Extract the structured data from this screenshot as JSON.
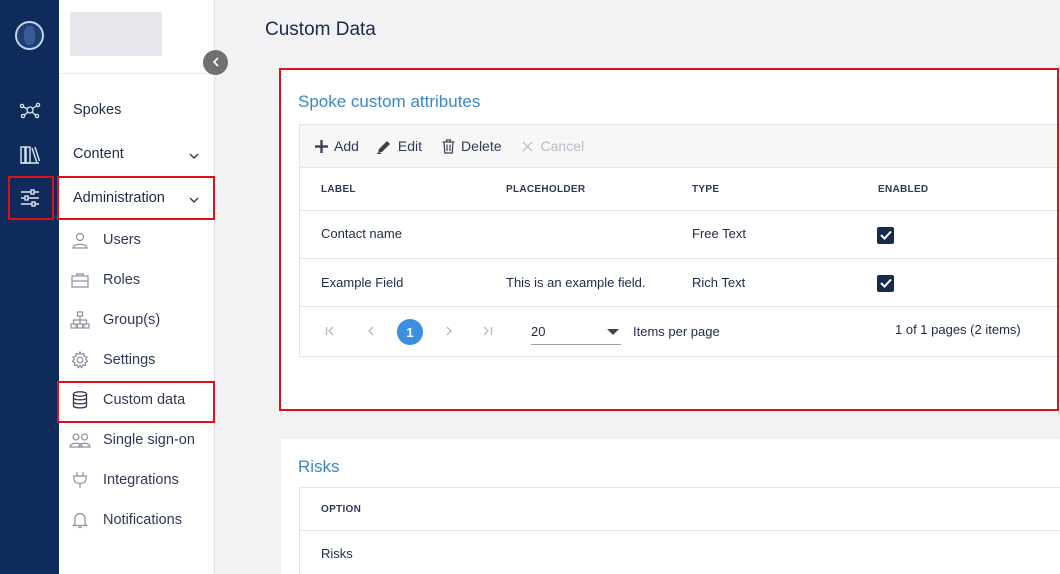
{
  "page": {
    "title": "Custom Data"
  },
  "nav": {
    "top_items": [
      {
        "label": "Spokes"
      },
      {
        "label": "Content"
      },
      {
        "label": "Administration"
      }
    ],
    "sub_items": [
      {
        "label": "Users",
        "icon": "user-icon"
      },
      {
        "label": "Roles",
        "icon": "briefcase-icon"
      },
      {
        "label": "Group(s)",
        "icon": "hierarchy-icon"
      },
      {
        "label": "Settings",
        "icon": "gear-icon"
      },
      {
        "label": "Custom data",
        "icon": "database-icon"
      },
      {
        "label": "Single sign-on",
        "icon": "users-icon"
      },
      {
        "label": "Integrations",
        "icon": "plug-icon"
      },
      {
        "label": "Notifications",
        "icon": "bell-icon"
      }
    ]
  },
  "custom_attributes": {
    "title": "Spoke custom attributes",
    "toolbar": {
      "add": "Add",
      "edit": "Edit",
      "delete": "Delete",
      "cancel": "Cancel"
    },
    "columns": [
      "LABEL",
      "PLACEHOLDER",
      "TYPE",
      "ENABLED"
    ],
    "rows": [
      {
        "label": "Contact name",
        "placeholder": "",
        "type": "Free Text",
        "enabled": true
      },
      {
        "label": "Example Field",
        "placeholder": "This is an example field.",
        "type": "Rich Text",
        "enabled": true
      }
    ],
    "pager": {
      "current_page": "1",
      "page_size": "20",
      "items_per_page_label": "Items per page",
      "summary": "1 of 1 pages (2 items)"
    }
  },
  "risks": {
    "title": "Risks",
    "columns": [
      "OPTION"
    ],
    "rows": [
      {
        "option": "Risks"
      }
    ]
  },
  "colors": {
    "rail": "#0f2b5b",
    "accent": "#3b86c4",
    "highlight": "#e0101a",
    "page_button": "#3b8ee0"
  }
}
